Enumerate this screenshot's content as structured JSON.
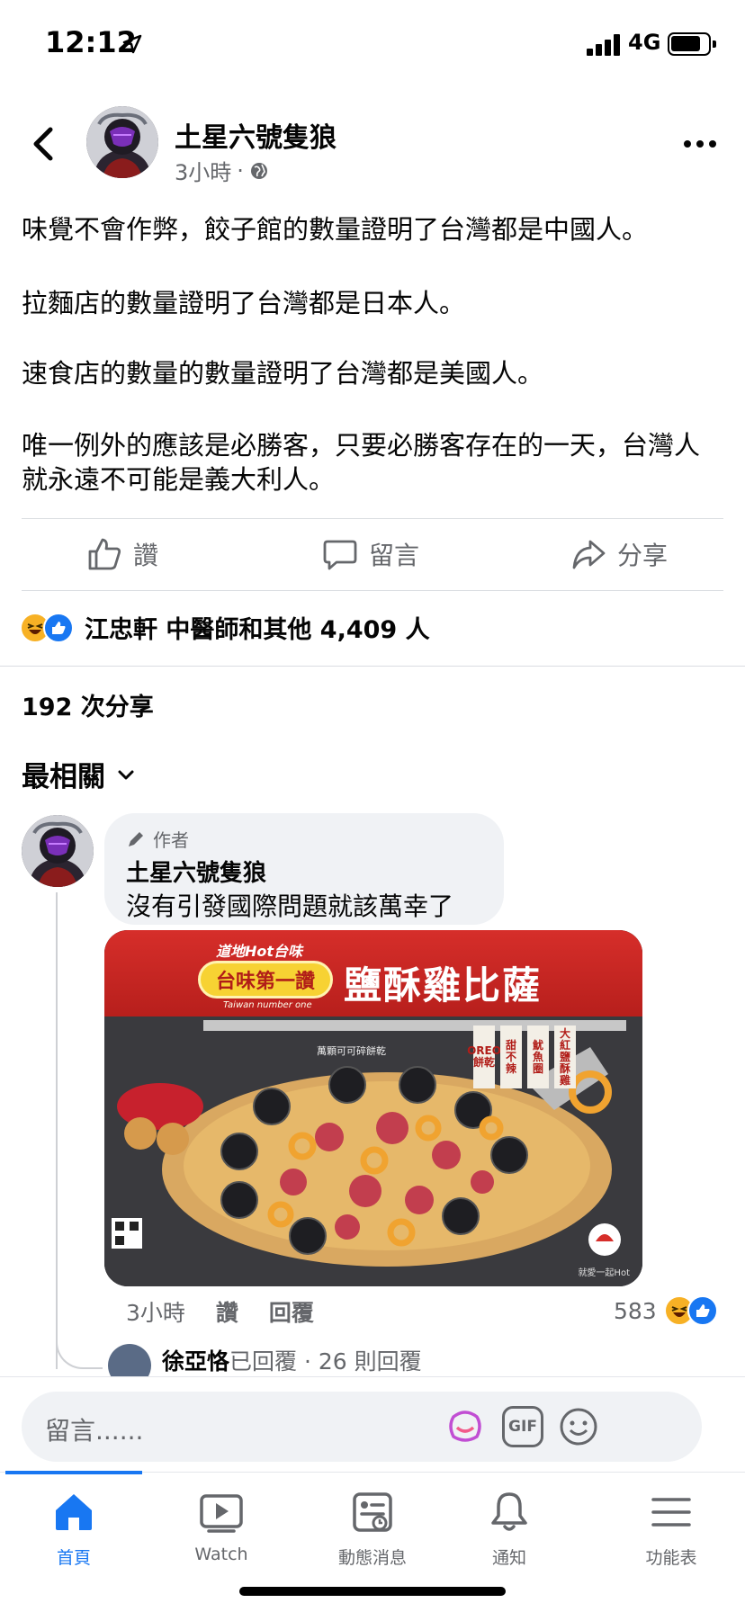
{
  "status_bar": {
    "time": "12:12",
    "network": "4G"
  },
  "post": {
    "author": "土星六號隻狼",
    "time": "3小時",
    "meta_separator": "·",
    "paragraphs": [
      "味覺不會作弊，餃子館的數量證明了台灣都是中國人。",
      "拉麵店的數量證明了台灣都是日本人。",
      "速食店的數量的數量證明了台灣都是美國人。",
      "唯一例外的應該是必勝客，只要必勝客存在的一天，台灣人就永遠不可能是義大利人。"
    ],
    "actions": {
      "like": "讚",
      "comment": "留言",
      "share": "分享"
    },
    "reactions_text": "江忠軒 中醫師和其他 4,409 人",
    "shares_text": "192 次分享"
  },
  "comments_section": {
    "sort_label": "最相關",
    "comment": {
      "badge": "作者",
      "name": "土星六號隻狼",
      "text": "沒有引發國際問題就該萬幸了",
      "time": "3小時",
      "like": "讚",
      "reply": "回覆",
      "reaction_count": "583"
    },
    "reply_preview": {
      "name": "徐亞恪",
      "action": "已回覆",
      "count": "26 則回覆"
    }
  },
  "ad_image": {
    "tag": "道地Hot台味",
    "pill": "台味第一讚",
    "subtitle": "Taiwan number one",
    "title": "鹽酥雞比薩",
    "cards": [
      "OREO餅乾",
      "甜不辣",
      "魷魚圈",
      "大紅鹽酥雞"
    ],
    "note": "萬顆可可碎餅乾",
    "footer_right": "就愛一起Hot"
  },
  "composer": {
    "placeholder": "留言......",
    "gif": "GIF"
  },
  "tabs": [
    {
      "label": "首頁",
      "icon": "home-icon"
    },
    {
      "label": "Watch",
      "icon": "watch-icon"
    },
    {
      "label": "動態消息",
      "icon": "news-feed-icon"
    },
    {
      "label": "通知",
      "icon": "bell-icon"
    },
    {
      "label": "功能表",
      "icon": "menu-icon"
    }
  ],
  "colors": {
    "accent": "#1877f2",
    "secondary_text": "#65676b",
    "haha": "#f7b125",
    "like": "#1877f2"
  }
}
